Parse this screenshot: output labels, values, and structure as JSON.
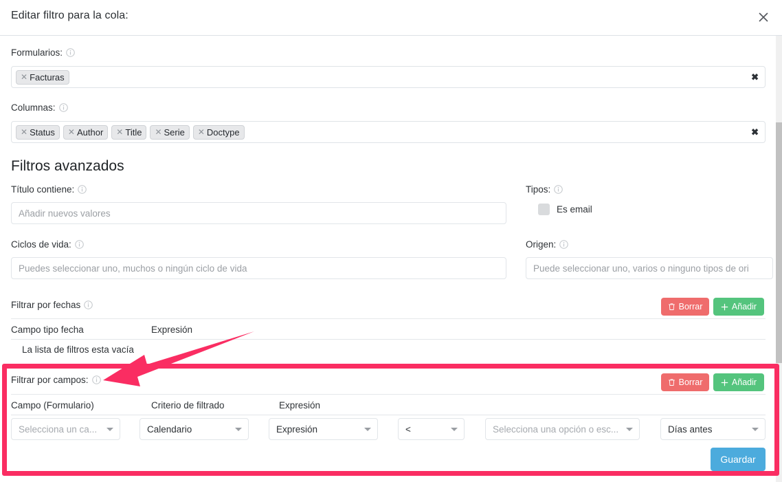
{
  "header": {
    "title": "Editar filtro para la cola:",
    "close_icon": "close-icon"
  },
  "forms_field": {
    "label": "Formularios:",
    "info_icon": "info-icon",
    "tags": [
      "Facturas"
    ],
    "clear_label": "✖"
  },
  "columns_field": {
    "label": "Columnas:",
    "info_icon": "info-icon",
    "tags": [
      "Status",
      "Author",
      "Title",
      "Serie",
      "Doctype"
    ],
    "clear_label": "✖"
  },
  "advanced": {
    "section_title": "Filtros avanzados",
    "title_contains": {
      "label": "Título contiene:",
      "placeholder": "Añadir nuevos valores",
      "value": ""
    },
    "types": {
      "label": "Tipos:",
      "checkbox_label": "Es email",
      "checked": false
    },
    "lifecycles": {
      "label": "Ciclos de vida:",
      "placeholder": "Puedes seleccionar uno, muchos o ningún ciclo de vida",
      "value": ""
    },
    "origin": {
      "label": "Origen:",
      "placeholder": "Puede seleccionar uno, varios o ninguno tipos de ori",
      "value": ""
    }
  },
  "date_filters": {
    "label": "Filtrar por fechas",
    "info_icon": "info-icon",
    "delete_label": "Borrar",
    "add_label": "Añadir",
    "delete_icon": "trash-icon",
    "add_icon": "plus-icon",
    "columns": [
      "Campo tipo fecha",
      "Expresión"
    ],
    "empty_message": "La lista de filtros esta vacía"
  },
  "field_filters": {
    "label": "Filtrar por campos:",
    "info_icon": "info-icon",
    "delete_label": "Borrar",
    "add_label": "Añadir",
    "delete_icon": "trash-icon",
    "add_icon": "plus-icon",
    "columns": [
      "Campo (Formulario)",
      "Criterio de filtrado",
      "Expresión"
    ],
    "row": {
      "field_select": {
        "value": "Selecciona un ca...",
        "is_placeholder": true
      },
      "criteria_select": {
        "value": "Calendario",
        "is_placeholder": false
      },
      "expression_select": {
        "value": "Expresión",
        "is_placeholder": false
      },
      "operator_select": {
        "value": "<",
        "is_placeholder": false
      },
      "option_select": {
        "value": "Selecciona una opción o esc...",
        "is_placeholder": true
      },
      "offset_select": {
        "value": "Días antes",
        "is_placeholder": false
      }
    }
  },
  "footer": {
    "save_label": "Guardar"
  },
  "annotation": {
    "highlight_color": "#fa2d62",
    "arrow_color": "#f5traf"
  },
  "colors": {
    "accent": "#4cabdd",
    "danger": "#ef6c6c",
    "success": "#54c47d",
    "highlight": "#fa2d62"
  }
}
